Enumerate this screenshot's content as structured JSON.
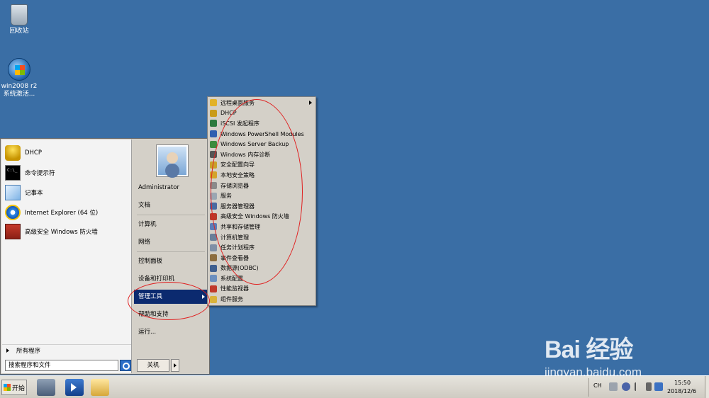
{
  "desktop": {
    "icons": [
      {
        "label": "回收站"
      },
      {
        "label_line1": "win2008 r2",
        "label_line2": "系统激活..."
      }
    ]
  },
  "start_menu": {
    "pinned": [
      "DHCP",
      "命令提示符",
      "记事本",
      "Internet Explorer (64 位)",
      "高级安全 Windows 防火墙"
    ],
    "all_programs": "所有程序",
    "search_placeholder": "搜索程序和文件",
    "user": "Administrator",
    "right_items": [
      "文档",
      "计算机",
      "网络",
      "控制面板",
      "设备和打印机",
      "管理工具",
      "帮助和支持",
      "运行..."
    ],
    "selected_item": "管理工具",
    "shutdown": "关机"
  },
  "admin_tools": {
    "items": [
      "远程桌面服务",
      "DHCP",
      "iSCSI 发起程序",
      "Windows PowerShell Modules",
      "Windows Server Backup",
      "Windows 内存诊断",
      "安全配置向导",
      "本地安全策略",
      "存储浏览器",
      "服务",
      "服务器管理器",
      "高级安全 Windows 防火墙",
      "共享和存储管理",
      "计算机管理",
      "任务计划程序",
      "事件查看器",
      "数据源(ODBC)",
      "系统配置",
      "性能监视器",
      "组件服务"
    ],
    "icon_colors": [
      "#e2b227",
      "#c99b18",
      "#2c7a3d",
      "#2e5fb0",
      "#3d8c3d",
      "#555555",
      "#c9a12a",
      "#d4a32a",
      "#8a8a8a",
      "#9aa6b2",
      "#4a6aa0",
      "#b8392a",
      "#5b7db8",
      "#6a7f99",
      "#7f8fa6",
      "#8c6d3f",
      "#3f5f8f",
      "#6b8fbf",
      "#c0392b",
      "#d9b23a"
    ]
  },
  "taskbar": {
    "start_label": "开始",
    "lang": "CH",
    "time": "15:50",
    "date": "2018/12/6"
  },
  "watermark": {
    "logo": "Bai 经验",
    "url": "jingyan.baidu.com"
  }
}
